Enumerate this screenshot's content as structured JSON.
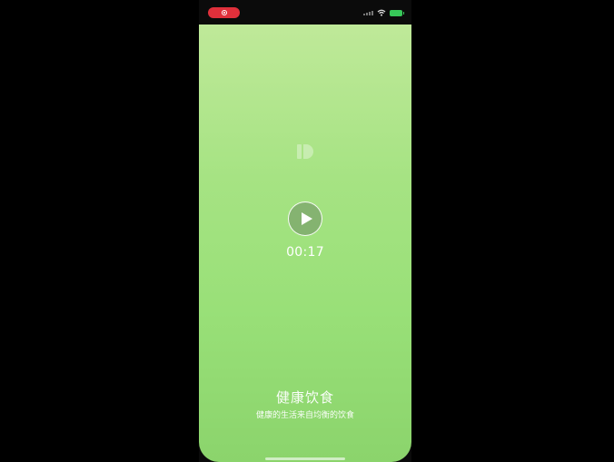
{
  "status_bar": {
    "recording_indicator": "record-icon",
    "wifi": "wifi-icon",
    "battery": "battery-charging-icon",
    "battery_color": "#37c759",
    "record_color": "#e0303b"
  },
  "video": {
    "logo_icon": "app-logo-icon",
    "play_icon": "play-icon",
    "duration": "00:17"
  },
  "caption": {
    "title": "健康饮食",
    "subtitle": "健康的生活来自均衡的饮食"
  },
  "colors": {
    "background_top": "#bfe999",
    "background_bottom": "#8bd46c"
  }
}
